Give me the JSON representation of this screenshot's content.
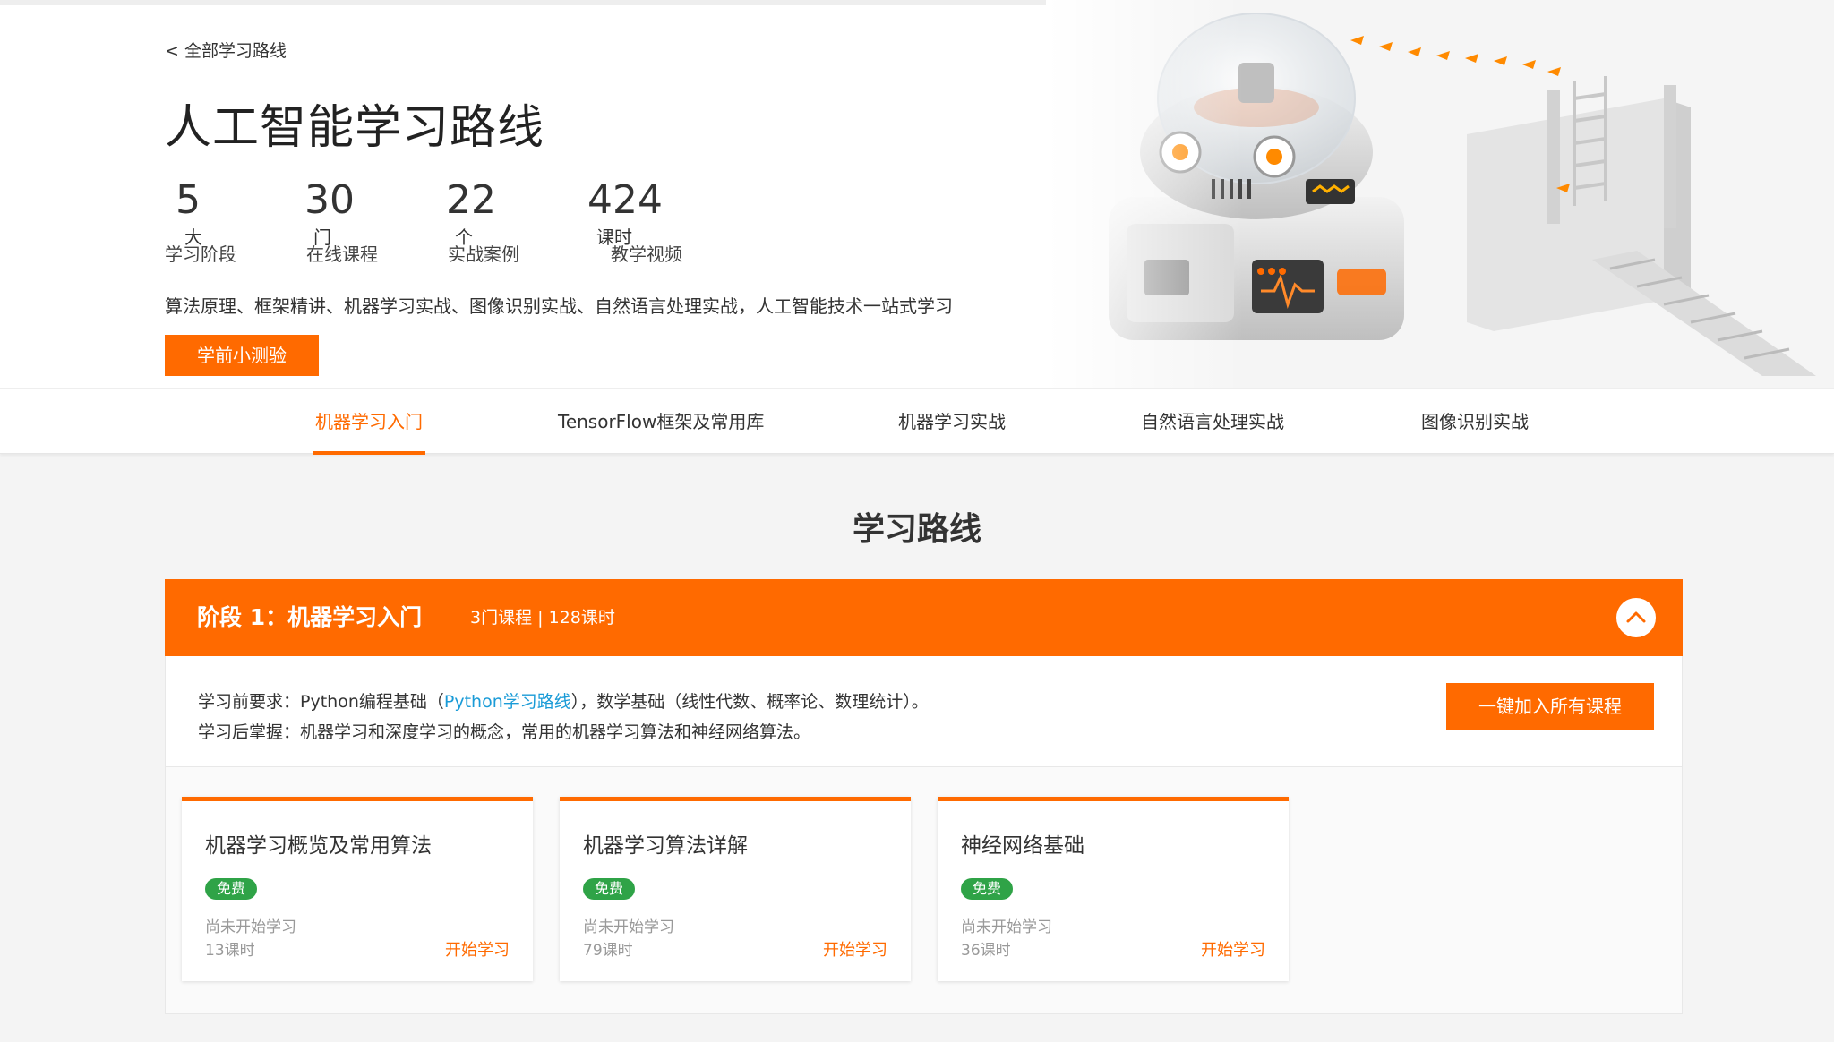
{
  "hero": {
    "back_link": "< 全部学习路线",
    "title": "人工智能学习路线",
    "stats": [
      {
        "value": "5",
        "unit": "大",
        "label": "学习阶段"
      },
      {
        "value": "30",
        "unit": "门",
        "label": "在线课程"
      },
      {
        "value": "22",
        "unit": "个",
        "label": "实战案例"
      },
      {
        "value": "424",
        "unit": "课时",
        "label": "教学视频"
      }
    ],
    "description": "算法原理、框架精讲、机器学习实战、图像识别实战、自然语言处理实战，人工智能技术一站式学习",
    "quiz_button": "学前小测验"
  },
  "tabs": [
    {
      "label": "机器学习入门",
      "active": true
    },
    {
      "label": "TensorFlow框架及常用库",
      "active": false
    },
    {
      "label": "机器学习实战",
      "active": false
    },
    {
      "label": "自然语言处理实战",
      "active": false
    },
    {
      "label": "图像识别实战",
      "active": false
    }
  ],
  "section_title": "学习路线",
  "stage": {
    "title": "阶段 1：机器学习入门",
    "meta": "3门课程 | 128课时",
    "prereq_prefix": "学习前要求：Python编程基础（",
    "prereq_link": "Python学习路线",
    "prereq_suffix": "），数学基础（线性代数、概率论、数理统计）。",
    "outcome": "学习后掌握：机器学习和深度学习的概念，常用的机器学习算法和神经网络算法。",
    "join_all_button": "一键加入所有课程",
    "courses": [
      {
        "title": "机器学习概览及常用算法",
        "badge": "免费",
        "status": "尚未开始学习",
        "hours": "13课时",
        "action": "开始学习"
      },
      {
        "title": "机器学习算法详解",
        "badge": "免费",
        "status": "尚未开始学习",
        "hours": "79课时",
        "action": "开始学习"
      },
      {
        "title": "神经网络基础",
        "badge": "免费",
        "status": "尚未开始学习",
        "hours": "36课时",
        "action": "开始学习"
      }
    ]
  },
  "colors": {
    "accent": "#ff6a00",
    "link": "#1a9bd7",
    "free_badge": "#2fa347"
  },
  "icons": {
    "collapse": "chevron-up-icon",
    "hero_illustration": "robot-illustration"
  }
}
